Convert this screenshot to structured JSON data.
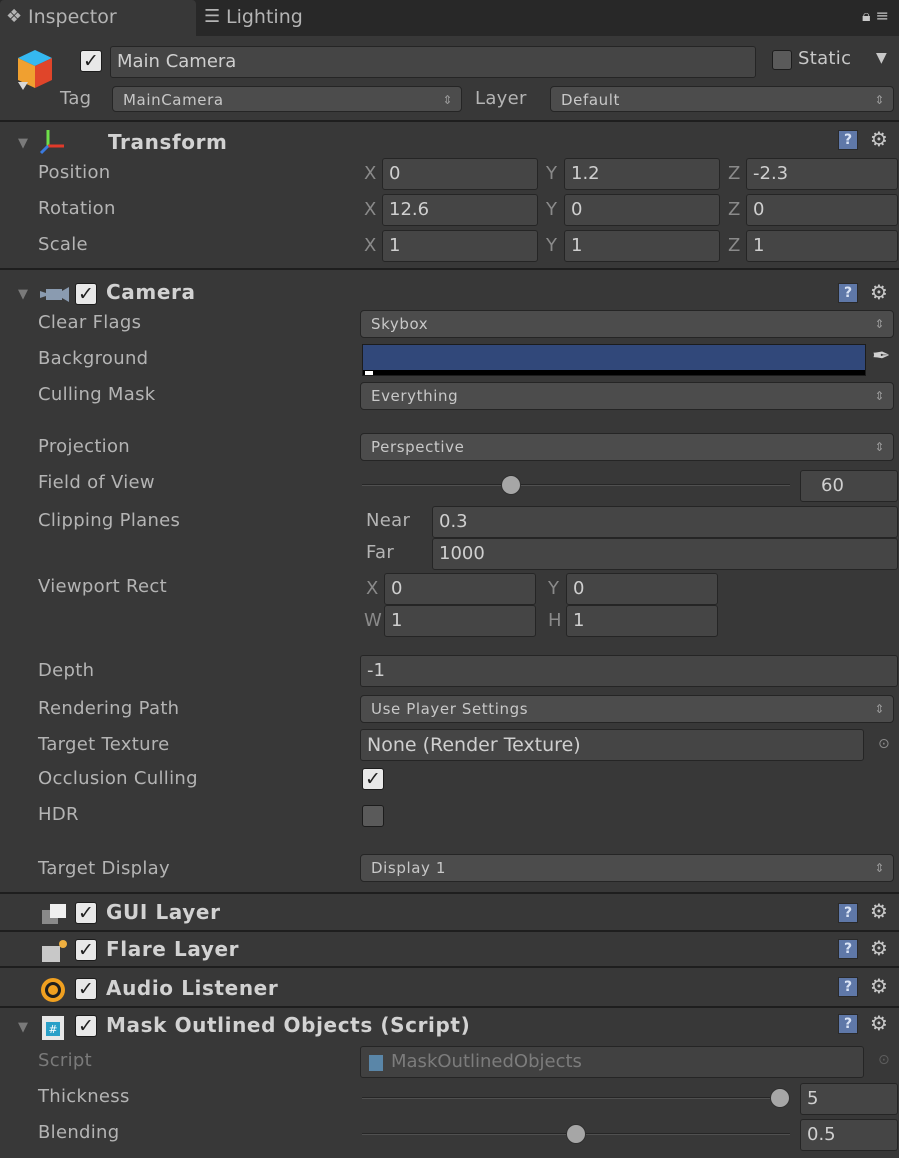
{
  "tabs": [
    {
      "label": "Inspector",
      "icon": "info-icon"
    },
    {
      "label": "Lighting",
      "icon": "lighting-icon"
    }
  ],
  "header": {
    "object_name": "Main Camera",
    "active": true,
    "static_label": "Static",
    "tag_label": "Tag",
    "tag_value": "MainCamera",
    "layer_label": "Layer",
    "layer_value": "Default"
  },
  "transform": {
    "title": "Transform",
    "rows": [
      {
        "label": "Position",
        "x": "0",
        "y": "1.2",
        "z": "-2.3"
      },
      {
        "label": "Rotation",
        "x": "12.6",
        "y": "0",
        "z": "0"
      },
      {
        "label": "Scale",
        "x": "1",
        "y": "1",
        "z": "1"
      }
    ],
    "axis": {
      "x": "X",
      "y": "Y",
      "z": "Z"
    }
  },
  "camera": {
    "title": "Camera",
    "enabled": true,
    "clear_flags_label": "Clear Flags",
    "clear_flags_value": "Skybox",
    "background_label": "Background",
    "background_color": "#31487a",
    "culling_mask_label": "Culling Mask",
    "culling_mask_value": "Everything",
    "projection_label": "Projection",
    "projection_value": "Perspective",
    "fov_label": "Field of View",
    "fov_value": "60",
    "fov_fraction": 0.34,
    "clipping_label": "Clipping Planes",
    "near_label": "Near",
    "near_value": "0.3",
    "far_label": "Far",
    "far_value": "1000",
    "viewport_label": "Viewport Rect",
    "vp": {
      "x_label": "X",
      "x": "0",
      "y_label": "Y",
      "y": "0",
      "w_label": "W",
      "w": "1",
      "h_label": "H",
      "h": "1"
    },
    "depth_label": "Depth",
    "depth_value": "-1",
    "rendering_path_label": "Rendering Path",
    "rendering_path_value": "Use Player Settings",
    "target_texture_label": "Target Texture",
    "target_texture_value": "None (Render Texture)",
    "occlusion_label": "Occlusion Culling",
    "occlusion_checked": true,
    "hdr_label": "HDR",
    "hdr_checked": false,
    "target_display_label": "Target Display",
    "target_display_value": "Display 1"
  },
  "components": [
    {
      "title": "GUI Layer",
      "enabled": true,
      "icon": "gui-layer-icon"
    },
    {
      "title": "Flare Layer",
      "enabled": true,
      "icon": "flare-layer-icon"
    },
    {
      "title": "Audio Listener",
      "enabled": true,
      "icon": "audio-listener-icon"
    }
  ],
  "script_comp": {
    "title": "Mask Outlined Objects (Script)",
    "enabled": true,
    "script_label": "Script",
    "script_value": "MaskOutlinedObjects",
    "thickness_label": "Thickness",
    "thickness_value": "5",
    "thickness_fraction": 1.0,
    "blending_label": "Blending",
    "blending_value": "0.5",
    "blending_fraction": 0.5
  },
  "colors": {
    "panel": "#383838",
    "tabbar": "#282828",
    "help_icon": "#5f78a8",
    "audio_icon": "#f0a020"
  }
}
